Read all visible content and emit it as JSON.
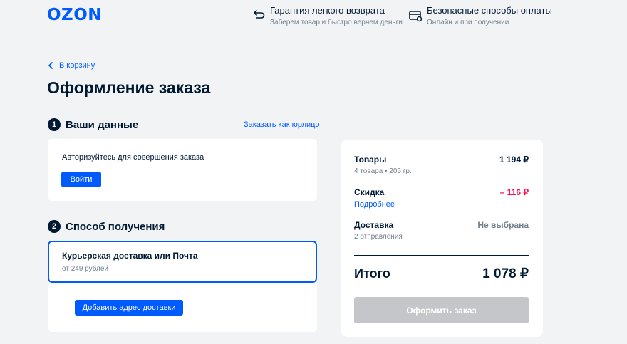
{
  "header": {
    "logo": "OZON",
    "promos": [
      {
        "icon": "return-arrow-icon",
        "title": "Гарантия легкого возврата",
        "subtitle": "Заберем товар и быстро вернем деньги"
      },
      {
        "icon": "credit-card-icon",
        "title": "Безопасные способы оплаты",
        "subtitle": "Онлайн и при получении"
      }
    ]
  },
  "nav": {
    "back_label": "В корзину"
  },
  "page": {
    "title": "Оформление заказа"
  },
  "section1": {
    "number": "1",
    "title": "Ваши данные",
    "legal_link": "Заказать как юрлицо",
    "auth_text": "Авторизуйтесь для совершения заказа",
    "login_button": "Войти"
  },
  "section2": {
    "number": "2",
    "title": "Способ получения",
    "option_title": "Курьерская доставка или Почта",
    "option_price": "от 249 рублей",
    "add_address_button": "Добавить адрес доставки"
  },
  "summary": {
    "goods_label": "Товары",
    "goods_sub": "4 товара • 205 гр.",
    "goods_value": "1 194 ₽",
    "discount_label": "Скидка",
    "discount_link": "Подробнее",
    "discount_value": "– 116 ₽",
    "delivery_label": "Доставка",
    "delivery_sub": "2 отправления",
    "delivery_value": "Не выбрана",
    "total_label": "Итого",
    "total_value": "1 078 ₽",
    "checkout_button": "Оформить заказ"
  },
  "colors": {
    "accent": "#005bff",
    "text": "#001a34",
    "muted": "#707f8d",
    "discount": "#f91155",
    "disabled_button": "#c4c6c9",
    "background": "#f2f3f5"
  }
}
